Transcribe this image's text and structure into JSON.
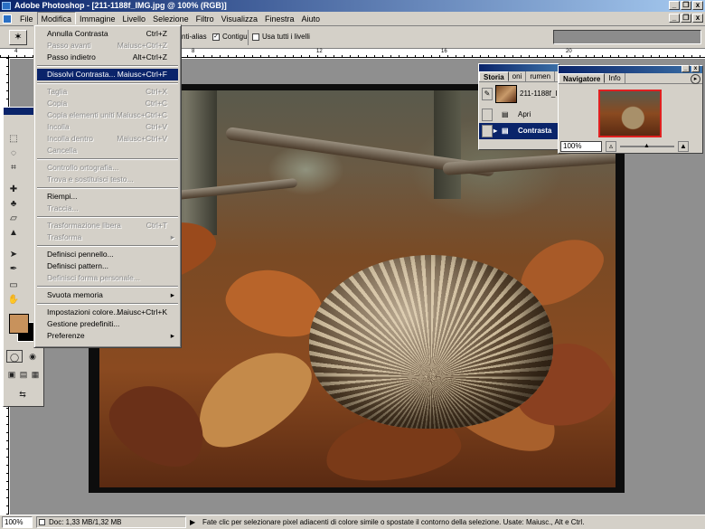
{
  "window": {
    "title": "Adobe Photoshop - [211-1188f_IMG.jpg @ 100% (RGB)]",
    "controls": [
      "_",
      "❐",
      "x"
    ]
  },
  "menubar": {
    "items": [
      "File",
      "Modifica",
      "Immagine",
      "Livello",
      "Selezione",
      "Filtro",
      "Visualizza",
      "Finestra",
      "Aiuto"
    ],
    "active": "Modifica"
  },
  "options_bar": {
    "antialias_label": "nti-alias",
    "contigui_label": "Contigui",
    "contigui_checked": true,
    "usa_tutti_label": "Usa tutti i livelli",
    "usa_tutti_checked": false
  },
  "ruler": {
    "labels": [
      "4",
      "8",
      "12",
      "16",
      "20"
    ]
  },
  "edit_menu": {
    "items": [
      {
        "label": "Annulla Contrasta",
        "shortcut": "Ctrl+Z",
        "disabled": false
      },
      {
        "label": "Passo avanti",
        "shortcut": "Maiusc+Ctrl+Z",
        "disabled": true
      },
      {
        "label": "Passo indietro",
        "shortcut": "Alt+Ctrl+Z",
        "disabled": false
      },
      {
        "label": "Dissolvi Contrasta...",
        "shortcut": "Maiusc+Ctrl+F",
        "disabled": false,
        "highlighted": true
      },
      {
        "label": "Taglia",
        "shortcut": "Ctrl+X",
        "disabled": true
      },
      {
        "label": "Copia",
        "shortcut": "Ctrl+C",
        "disabled": true
      },
      {
        "label": "Copia elementi uniti",
        "shortcut": "Maiusc+Ctrl+C",
        "disabled": true
      },
      {
        "label": "Incolla",
        "shortcut": "Ctrl+V",
        "disabled": true
      },
      {
        "label": "Incolla dentro",
        "shortcut": "Maiusc+Ctrl+V",
        "disabled": true
      },
      {
        "label": "Cancella",
        "shortcut": "",
        "disabled": true
      },
      {
        "label": "Controllo ortografia...",
        "shortcut": "",
        "disabled": true
      },
      {
        "label": "Trova e sostituisci testo...",
        "shortcut": "",
        "disabled": true
      },
      {
        "label": "Riempi...",
        "shortcut": "",
        "disabled": false
      },
      {
        "label": "Traccia...",
        "shortcut": "",
        "disabled": true
      },
      {
        "label": "Trasformazione libera",
        "shortcut": "Ctrl+T",
        "disabled": true
      },
      {
        "label": "Trasforma",
        "shortcut": "",
        "disabled": true,
        "submenu": true
      },
      {
        "label": "Definisci pennello...",
        "shortcut": "",
        "disabled": false
      },
      {
        "label": "Definisci pattern...",
        "shortcut": "",
        "disabled": false
      },
      {
        "label": "Definisci forma personale...",
        "shortcut": "",
        "disabled": true
      },
      {
        "label": "Svuota memoria",
        "shortcut": "",
        "disabled": false,
        "submenu": true
      },
      {
        "label": "Impostazioni colore...",
        "shortcut": "Maiusc+Ctrl+K",
        "disabled": false
      },
      {
        "label": "Gestione predefiniti...",
        "shortcut": "",
        "disabled": false
      },
      {
        "label": "Preferenze",
        "shortcut": "",
        "disabled": false,
        "submenu": true
      }
    ]
  },
  "history_palette": {
    "tabs": [
      "Storia",
      "oni",
      "rumen"
    ],
    "snapshot_name": "211-1188f_IMG.jpg",
    "steps": [
      {
        "label": "Apri",
        "selected": false
      },
      {
        "label": "Contrasta",
        "selected": true
      }
    ]
  },
  "navigator_palette": {
    "tabs": [
      "Navigatore",
      "Info"
    ],
    "zoom": "100%"
  },
  "colors": {
    "foreground": "#c8925c",
    "background": "#000000",
    "highlight": "#0a246a"
  },
  "status_bar": {
    "zoom": "100%",
    "doc_info": "Doc: 1,33 MB/1,32 MB",
    "hint": "Fate clic per selezionare pixel adiacenti di colore simile o spostate il contorno della selezione. Usate: Maiusc., Alt e Ctrl."
  }
}
